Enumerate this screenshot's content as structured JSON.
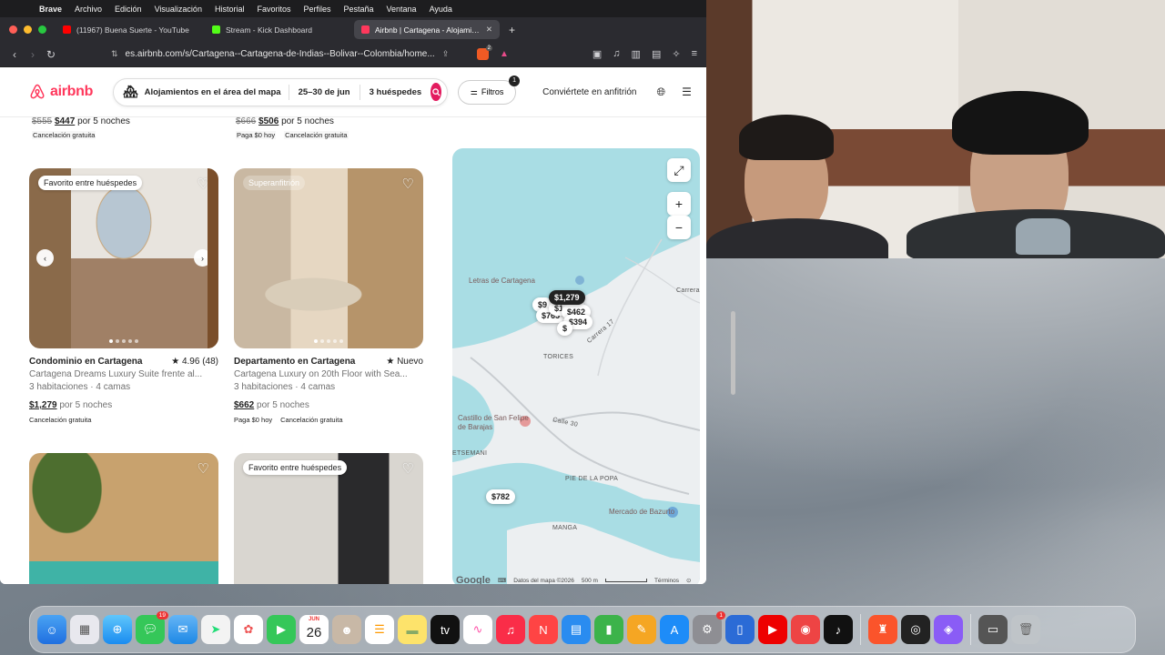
{
  "menubar": {
    "app": "Brave",
    "items": [
      "Archivo",
      "Edición",
      "Visualización",
      "Historial",
      "Favoritos",
      "Perfiles",
      "Pestaña",
      "Ventana",
      "Ayuda"
    ]
  },
  "browser": {
    "tabs": [
      {
        "title": "(11967) Buena Suerte - YouTube",
        "icon_color": "#ff0000"
      },
      {
        "title": "Stream - Kick Dashboard",
        "icon_color": "#53fc18"
      },
      {
        "title": "Airbnb | Cartagena - Alojamientos",
        "icon_color": "#ff385c"
      }
    ],
    "url": "es.airbnb.com/s/Cartagena--Cartagena-de-Indias--Bolivar--Colombia/home...",
    "shield_badge": "2"
  },
  "airbnb": {
    "logo": "airbnb",
    "search": {
      "location": "Alojamientos en el área del mapa",
      "dates": "25–30 de jun",
      "guests": "3 huéspedes"
    },
    "filters_label": "Filtros",
    "filters_count": "1",
    "host_link": "Conviértete en anfitrión"
  },
  "top_row": [
    {
      "old_price": "$555",
      "price": "$447",
      "nights": "por 5 noches",
      "tags": [
        "Cancelación gratuita"
      ]
    },
    {
      "old_price": "$666",
      "price": "$506",
      "nights": "por 5 noches",
      "tags": [
        "Paga $0 hoy",
        "Cancelación gratuita"
      ]
    }
  ],
  "listings": [
    {
      "badge": "Favorito entre huéspedes",
      "title": "Condominio en Cartagena",
      "rating": "★ 4.96 (48)",
      "desc": "Cartagena Dreams Luxury Suite frente al...",
      "beds": "3 habitaciones · 4 camas",
      "price": "$1,279",
      "nights": "por 5 noches",
      "tags": [
        "Cancelación gratuita"
      ]
    },
    {
      "badge": "Superanfitrión",
      "title": "Departamento en Cartagena",
      "rating": "★ Nuevo",
      "desc": "Cartagena Luxury on 20th Floor with Sea...",
      "beds": "3 habitaciones · 4 camas",
      "price": "$662",
      "nights": "por 5 noches",
      "tags": [
        "Paga $0 hoy",
        "Cancelación gratuita"
      ]
    },
    {
      "badge": ""
    },
    {
      "badge": "Favorito entre huéspedes"
    }
  ],
  "map": {
    "pins": [
      "$1,279",
      "$9",
      "$765",
      "$1,024",
      "$462",
      "$394",
      "$",
      "$782"
    ],
    "labels": {
      "letras": "Letras de Cartagena",
      "torices": "TORICES",
      "castillo": "Castillo de San Felipe de Barajas",
      "calle": "Calle 30",
      "carrera": "Carrera 17",
      "carrera2": "Carrera",
      "estemani": "ETSEMANI",
      "popa": "PIE DE LA POPA",
      "bazurto": "Mercado de Bazurto",
      "manga": "MANGA"
    },
    "footer": {
      "google": "Google",
      "data": "Datos del mapa ©2026",
      "scale": "500 m",
      "terms": "Términos"
    }
  },
  "dock": {
    "calendar_month": "JUN",
    "calendar_day": "26",
    "messages_badge": "19",
    "settings_badge": "1"
  }
}
